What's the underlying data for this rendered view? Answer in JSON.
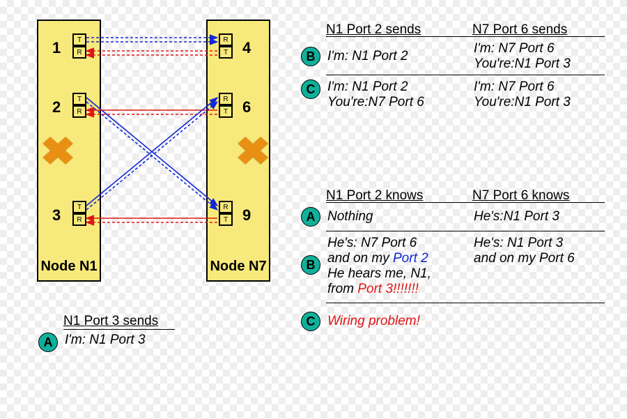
{
  "nodes": {
    "n1": {
      "label": "Node N1",
      "ports": [
        "1",
        "2",
        "3"
      ]
    },
    "n7": {
      "label": "Node N7",
      "ports": [
        "4",
        "6",
        "9"
      ]
    }
  },
  "tr": {
    "t": "T",
    "r": "R"
  },
  "sendsTable": {
    "h1": "N1 Port 2 sends",
    "h2": "N7 Port 6 sends",
    "B": {
      "c1l1": "I'm: N1 Port 2",
      "c2l1": "I'm: N7 Port 6",
      "c2l2": "You're:N1 Port 3"
    },
    "C": {
      "c1l1": "I'm: N1 Port 2",
      "c1l2": "You're:N7 Port 6",
      "c2l1": "I'm: N7 Port 6",
      "c2l2": "You're:N1 Port 3"
    }
  },
  "knowsTable": {
    "h1": "N1 Port 2 knows",
    "h2": "N7 Port 6 knows",
    "A": {
      "c1l1": "Nothing",
      "c2l1": "He's:N1 Port 3"
    },
    "B": {
      "c1l1_a": "He's: N7 Port 6",
      "c1l2_a": "and on my ",
      "c1l2_b": "Port 2",
      "c1l3": "He hears me, N1,",
      "c1l4_a": "from ",
      "c1l4_b": "Port 3!!!!!!!",
      "c2l1": "He's: N1 Port 3",
      "c2l2": "and on my Port 6"
    },
    "C": {
      "c1l1": "Wiring problem!"
    }
  },
  "leftSends": {
    "h": "N1 Port 3 sends",
    "l1": "I'm: N1 Port 3"
  },
  "badge": {
    "A": "A",
    "B": "B",
    "C": "C"
  },
  "colors": {
    "blue": "#1126d6",
    "red": "#e01515",
    "badge": "#11b09b",
    "node": "#f7e97b"
  }
}
